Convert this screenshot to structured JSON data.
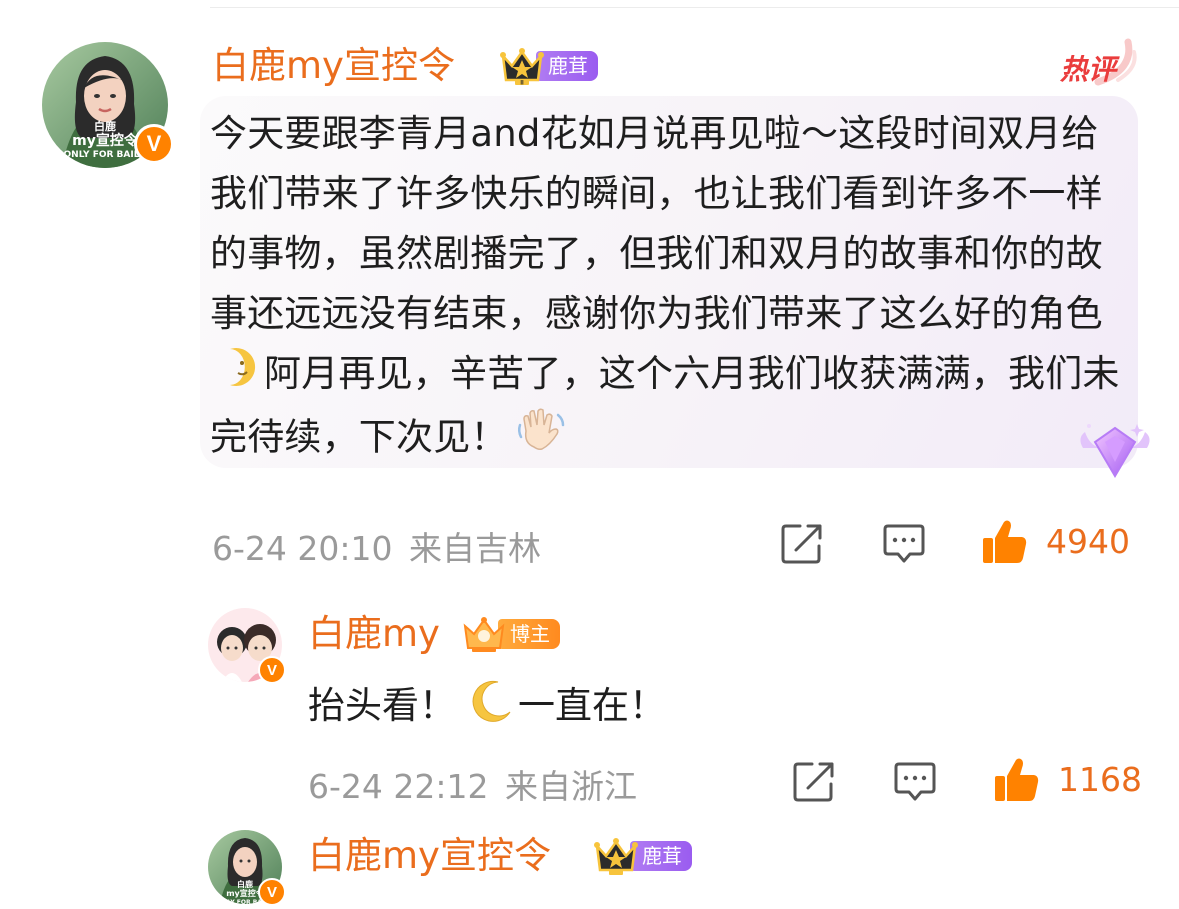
{
  "comment": {
    "username": "白鹿my宣控令",
    "badge_label": "鹿茸",
    "hot_label": "热评",
    "verified_glyph": "V",
    "text_parts": [
      "今天要跟李青月and花如月说再见啦～这段时间双月给我们带来了许多快乐的瞬间，也让我们看到许多不一样的事物，虽然剧播完了，但我们和双月的故事和你的故事还远远没有结束，感谢你为我们带来了这么好的角色",
      "阿月再见，辛苦了，这个六月我们收获满满，我们未完待续，下次见！"
    ],
    "emoji_icons": [
      "crescent-moon-face-icon",
      "waving-hand-icon"
    ],
    "timestamp": "6-24 20:10",
    "location": "来自吉林",
    "likes": "4940"
  },
  "reply": {
    "username": "白鹿my",
    "badge_label": "博主",
    "text_before": "抬头看！",
    "text_after": "一直在！",
    "emoji_icon": "crescent-moon-icon",
    "timestamp": "6-24 22:12",
    "location": "来自浙江",
    "likes": "1168"
  },
  "next_comment": {
    "username": "白鹿my宣控令",
    "badge_label": "鹿茸"
  },
  "avatar_text": {
    "line1": "白鹿",
    "line2": "my宣控令",
    "line3": "ONLY FOR BAILU"
  },
  "colors": {
    "username": "#ea6d1d",
    "meta_gray": "#9a9a9a",
    "like_orange": "#ff8200",
    "badge_purple": "#9a5cf0",
    "badge_orange": "#ff8a1f"
  }
}
